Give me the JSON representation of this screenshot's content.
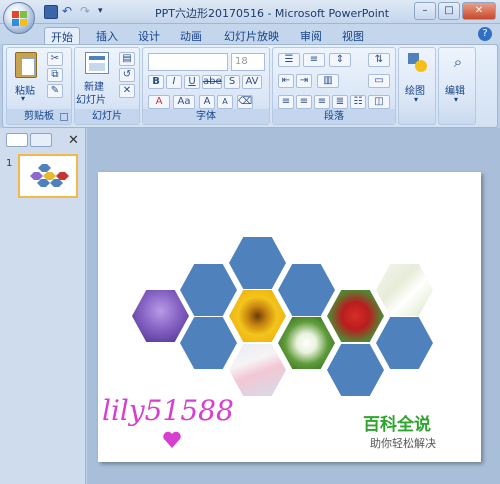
{
  "window": {
    "title": "PPT六边形20170516 - Microsoft PowerPoint",
    "controls": [
      "–",
      "□",
      "✕"
    ]
  },
  "tabs": [
    "开始",
    "插入",
    "设计",
    "动画",
    "幻灯片放映",
    "审阅",
    "视图"
  ],
  "ribbon": {
    "clipboard": {
      "label": "剪贴板",
      "paste": "粘贴"
    },
    "slides": {
      "label": "幻灯片",
      "new_slide_line1": "新建",
      "new_slide_line2": "幻灯片"
    },
    "font": {
      "label": "字体",
      "font_name": "",
      "font_size": "18",
      "bold": "B",
      "italic": "I",
      "underline": "U",
      "strike": "abe",
      "shadow": "S",
      "spacing": "AV",
      "case": "Aa",
      "grow": "A",
      "shrink": "A"
    },
    "paragraph": {
      "label": "段落"
    },
    "drawing": {
      "label": "绘图"
    },
    "editing": {
      "label": "编辑"
    }
  },
  "thumbnail": {
    "number": "1"
  },
  "slide": {
    "watermark_left": "lily51588",
    "watermark_right_title": "百科全说",
    "watermark_right_sub": "助你轻松解决"
  },
  "colors": {
    "hex_blue": "#4f81bd",
    "ribbon_bg": "#dae6f6",
    "watermark_pink": "#d63fd0",
    "watermark_green": "#2fa52f"
  },
  "hexagon_images": [
    "lavender-photo",
    "sunflower-photo",
    "white-flowers-photo",
    "red-roses-photo",
    "pale-flowers-photo",
    "white-blossom-photo"
  ]
}
